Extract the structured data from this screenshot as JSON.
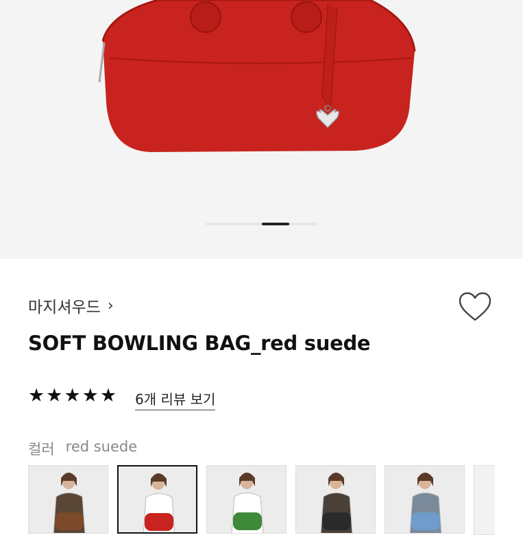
{
  "brand": {
    "name": "마지셔우드",
    "chevron": "›"
  },
  "product": {
    "title": "SOFT BOWLING BAG_red suede"
  },
  "rating": {
    "stars": 5,
    "review_link": "6개 리뷰 보기"
  },
  "color": {
    "label": "컬러",
    "value": "red suede"
  },
  "variants": [
    {
      "bag": "#7a4a2a",
      "top": "#5a4636"
    },
    {
      "bag": "#c8231e",
      "top": "#ffffff"
    },
    {
      "bag": "#3f8a3a",
      "top": "#ffffff"
    },
    {
      "bag": "#2a2a2a",
      "top": "#4a4038"
    },
    {
      "bag": "#6f9ccc",
      "top": "#7a8a9a"
    }
  ],
  "gallery": {
    "index": 2,
    "count": 4
  },
  "colors": {
    "bag_red": "#c8231e",
    "accent": "#111111"
  }
}
